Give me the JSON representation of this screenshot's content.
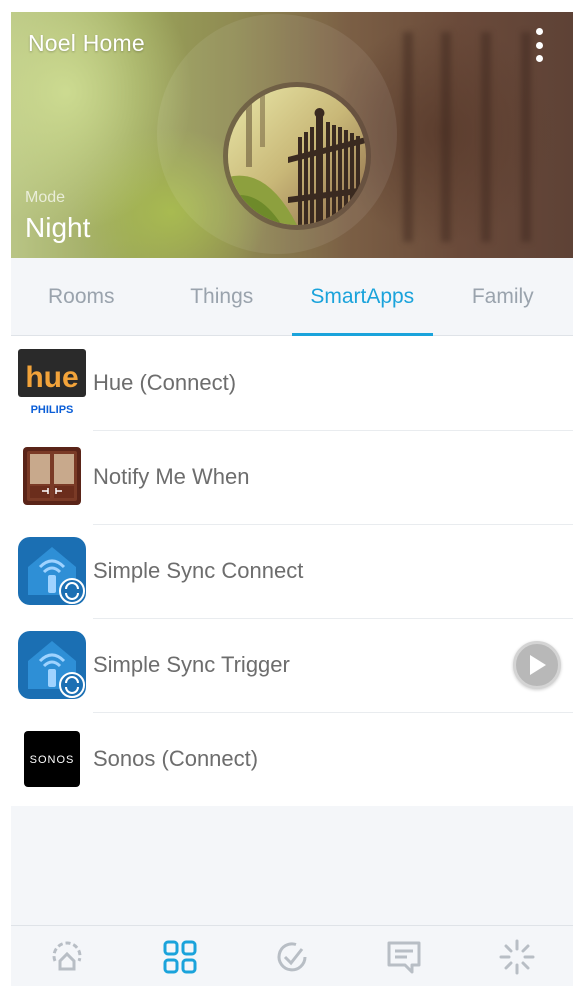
{
  "header": {
    "title": "Noel Home",
    "mode_label": "Mode",
    "mode_value": "Night"
  },
  "tabs": [
    {
      "label": "Rooms",
      "active": false
    },
    {
      "label": "Things",
      "active": false
    },
    {
      "label": "SmartApps",
      "active": true
    },
    {
      "label": "Family",
      "active": false
    }
  ],
  "smartapps": [
    {
      "name": "Hue (Connect)",
      "icon": "hue-philips-icon",
      "icon_text": "hue",
      "icon_subtext": "PHILIPS"
    },
    {
      "name": "Notify Me When",
      "icon": "door-icon"
    },
    {
      "name": "Simple Sync Connect",
      "icon": "simple-sync-icon"
    },
    {
      "name": "Simple Sync Trigger",
      "icon": "simple-sync-icon",
      "action": "play-icon"
    },
    {
      "name": "Sonos (Connect)",
      "icon": "sonos-icon",
      "icon_text": "SONOS"
    }
  ],
  "bottom_nav": [
    {
      "icon": "dashboard-icon",
      "active": false
    },
    {
      "icon": "grid-icon",
      "active": true
    },
    {
      "icon": "routines-check-icon",
      "active": false
    },
    {
      "icon": "notifications-icon",
      "active": false
    },
    {
      "icon": "marketplace-sparkle-icon",
      "active": false
    }
  ],
  "colors": {
    "accent": "#1aa3db",
    "inactive": "#9aa3ad",
    "text": "#6d6d6d",
    "background": "#f4f6f9"
  }
}
